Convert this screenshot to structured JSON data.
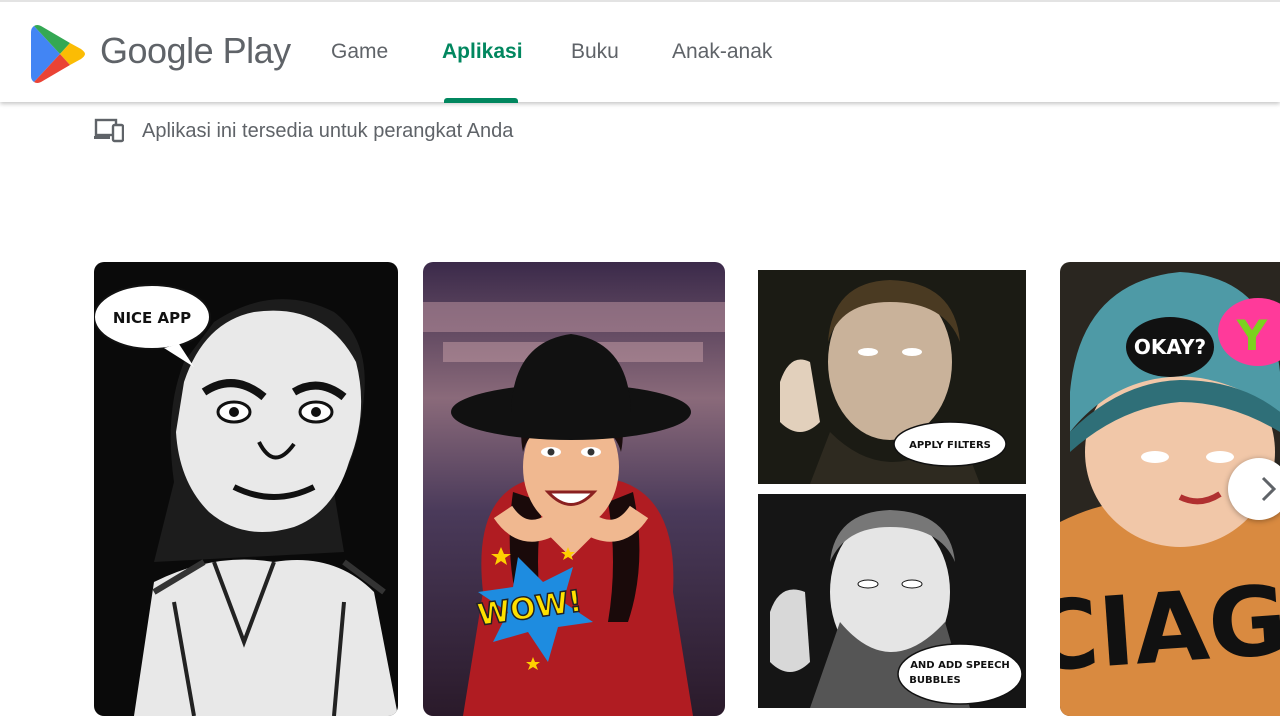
{
  "header": {
    "brand": "Google Play",
    "logo_icon": "google-play-logo-icon",
    "tabs": [
      {
        "label": "Game",
        "active": false
      },
      {
        "label": "Aplikasi",
        "active": true
      },
      {
        "label": "Buku",
        "active": false
      },
      {
        "label": "Anak-anak",
        "active": false
      }
    ],
    "accent_color": "#01875f"
  },
  "availability": {
    "icon": "devices-icon",
    "text": "Aplikasi ini tersedia untuk perangkat Anda"
  },
  "screenshots": [
    {
      "caption": "NICE APP"
    },
    {
      "caption": "WOW!"
    },
    {
      "captions": [
        "APPLY FILTERS",
        "AND ADD SPEECH",
        "BUBBLES"
      ]
    },
    {
      "captions": [
        "OKAY?",
        "Y"
      ],
      "shirt_text": "CIAG"
    }
  ],
  "carousel": {
    "next_icon": "chevron-right-icon"
  }
}
